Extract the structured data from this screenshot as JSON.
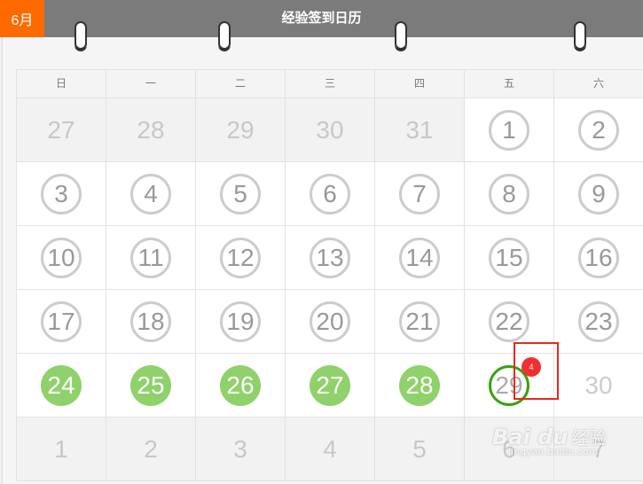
{
  "header": {
    "month_badge": "6月",
    "title": "经验签到日历"
  },
  "weekdays": [
    "日",
    "一",
    "二",
    "三",
    "四",
    "五",
    "六"
  ],
  "weeks": [
    [
      {
        "d": "27",
        "s": "prev"
      },
      {
        "d": "28",
        "s": "prev"
      },
      {
        "d": "29",
        "s": "prev"
      },
      {
        "d": "30",
        "s": "prev"
      },
      {
        "d": "31",
        "s": "prev"
      },
      {
        "d": "1",
        "s": "ring"
      },
      {
        "d": "2",
        "s": "ring"
      }
    ],
    [
      {
        "d": "3",
        "s": "ring"
      },
      {
        "d": "4",
        "s": "ring"
      },
      {
        "d": "5",
        "s": "ring"
      },
      {
        "d": "6",
        "s": "ring"
      },
      {
        "d": "7",
        "s": "ring"
      },
      {
        "d": "8",
        "s": "ring"
      },
      {
        "d": "9",
        "s": "ring"
      }
    ],
    [
      {
        "d": "10",
        "s": "ring"
      },
      {
        "d": "11",
        "s": "ring"
      },
      {
        "d": "12",
        "s": "ring"
      },
      {
        "d": "13",
        "s": "ring"
      },
      {
        "d": "14",
        "s": "ring"
      },
      {
        "d": "15",
        "s": "ring"
      },
      {
        "d": "16",
        "s": "ring"
      }
    ],
    [
      {
        "d": "17",
        "s": "ring"
      },
      {
        "d": "18",
        "s": "ring"
      },
      {
        "d": "19",
        "s": "ring"
      },
      {
        "d": "20",
        "s": "ring"
      },
      {
        "d": "21",
        "s": "ring"
      },
      {
        "d": "22",
        "s": "ring"
      },
      {
        "d": "23",
        "s": "ring"
      }
    ],
    [
      {
        "d": "24",
        "s": "signed"
      },
      {
        "d": "25",
        "s": "signed"
      },
      {
        "d": "26",
        "s": "signed"
      },
      {
        "d": "27",
        "s": "signed"
      },
      {
        "d": "28",
        "s": "signed"
      },
      {
        "d": "29",
        "s": "today"
      },
      {
        "d": "30",
        "s": "future"
      }
    ],
    [
      {
        "d": "1",
        "s": "next"
      },
      {
        "d": "2",
        "s": "next"
      },
      {
        "d": "3",
        "s": "next"
      },
      {
        "d": "4",
        "s": "next"
      },
      {
        "d": "5",
        "s": "next"
      },
      {
        "d": "6",
        "s": "next"
      },
      {
        "d": "7",
        "s": "next"
      }
    ]
  ],
  "today_badge": "4",
  "watermark": {
    "logo": "Bai du",
    "label": "经验",
    "url": "jingyan.baidu.com"
  },
  "colors": {
    "header": "#7b7b7b",
    "month_badge": "#ff6a00",
    "signed": "#8fd16a",
    "today_ring": "#3aa210",
    "badge": "#f03030",
    "highlight": "#e8291c"
  }
}
